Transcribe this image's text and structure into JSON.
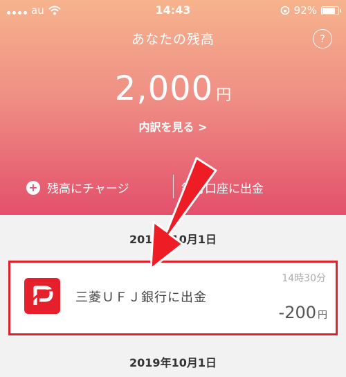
{
  "status_bar": {
    "carrier": "au",
    "time": "14:43",
    "battery": "92%",
    "battery_level": 0.92
  },
  "header": {
    "title": "あなたの残高",
    "help_symbol": "?"
  },
  "balance": {
    "amount": "2,000",
    "unit": "円",
    "breakdown_link": "内訳を見る >"
  },
  "actions": {
    "charge_label": "残高にチャージ",
    "withdraw_label": "銀行口座に出金"
  },
  "history": {
    "date_header_1": "2019年10月1日",
    "transaction": {
      "name": "三菱ＵＦＪ銀行に出金",
      "time": "14時30分",
      "amount": "-200",
      "unit": "円"
    },
    "date_header_2": "2019年10月1日"
  },
  "colors": {
    "highlight": "#e0202a",
    "logo": "#e51f2b",
    "arrow": "#ee1c24"
  },
  "icons": [
    "wifi-icon",
    "orientation-lock-icon",
    "battery-icon",
    "help-icon",
    "plus-icon",
    "paypay-logo",
    "annotation-arrow"
  ]
}
